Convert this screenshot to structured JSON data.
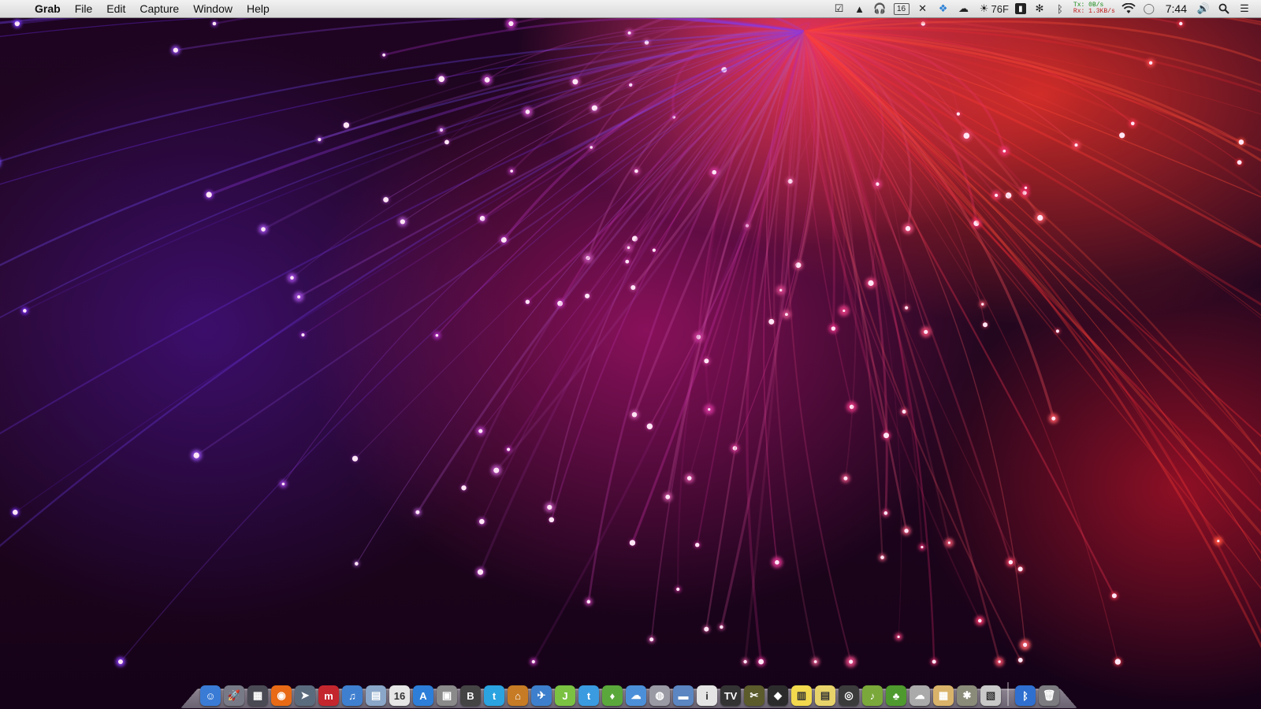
{
  "menubar": {
    "apple_glyph": "",
    "app_name": "Grab",
    "menus": [
      "File",
      "Edit",
      "Capture",
      "Window",
      "Help"
    ],
    "calendar_day": "16",
    "weather_temp": "76F",
    "net_tx_label": "Tx:",
    "net_tx_value": "0B/s",
    "net_rx_label": "Rx:",
    "net_rx_value": "1.3KB/s",
    "clock": "7:44"
  },
  "dock": {
    "items": [
      {
        "name": "finder",
        "glyph": "☺",
        "color": "#3a7bd5"
      },
      {
        "name": "launchpad",
        "glyph": "🚀",
        "color": "#777a86"
      },
      {
        "name": "mission-control",
        "glyph": "▦",
        "color": "#4a4a55"
      },
      {
        "name": "firefox",
        "glyph": "◉",
        "color": "#e86a16"
      },
      {
        "name": "sparrow",
        "glyph": "➤",
        "color": "#5b6b7e"
      },
      {
        "name": "mendeley",
        "glyph": "m",
        "color": "#c4262e"
      },
      {
        "name": "itunes",
        "glyph": "♫",
        "color": "#3f7fd0"
      },
      {
        "name": "preview",
        "glyph": "▤",
        "color": "#8aa6c8"
      },
      {
        "name": "ical",
        "glyph": "16",
        "color": "#e6e6e6"
      },
      {
        "name": "app-store",
        "glyph": "A",
        "color": "#2d7ed8"
      },
      {
        "name": "image-capture",
        "glyph": "▣",
        "color": "#8a8a8a"
      },
      {
        "name": "bbedit",
        "glyph": "B",
        "color": "#444444"
      },
      {
        "name": "twitter",
        "glyph": "t",
        "color": "#2aa3e0"
      },
      {
        "name": "home-app",
        "glyph": "⌂",
        "color": "#c77b24"
      },
      {
        "name": "xcode-tools",
        "glyph": "✈",
        "color": "#3d7fcc"
      },
      {
        "name": "jumpcut",
        "glyph": "J",
        "color": "#7bc243"
      },
      {
        "name": "tweetbot",
        "glyph": "t",
        "color": "#3a9be0"
      },
      {
        "name": "evernote",
        "glyph": "♦",
        "color": "#5aa83b"
      },
      {
        "name": "mindnode",
        "glyph": "☁",
        "color": "#4c8fd9"
      },
      {
        "name": "network-utility",
        "glyph": "◍",
        "color": "#9a9aa5"
      },
      {
        "name": "disk-utility",
        "glyph": "▬",
        "color": "#5b86c2"
      },
      {
        "name": "text-edit",
        "glyph": "i",
        "color": "#e4e4e4"
      },
      {
        "name": "tv-app",
        "glyph": "TV",
        "color": "#333333"
      },
      {
        "name": "scissors-app",
        "glyph": "✂",
        "color": "#5b5b2c"
      },
      {
        "name": "flux-app",
        "glyph": "◆",
        "color": "#2b2b2b"
      },
      {
        "name": "stickies",
        "glyph": "▥",
        "color": "#f2d94e"
      },
      {
        "name": "notes",
        "glyph": "▤",
        "color": "#e8d36a"
      },
      {
        "name": "chrome",
        "glyph": "◎",
        "color": "#3b3b3b"
      },
      {
        "name": "guitar-app",
        "glyph": "♪",
        "color": "#7aa83a"
      },
      {
        "name": "tree-app",
        "glyph": "♣",
        "color": "#4f9a2e"
      },
      {
        "name": "cloud-app",
        "glyph": "☁",
        "color": "#aaaaaa"
      },
      {
        "name": "calculator",
        "glyph": "▦",
        "color": "#d9b36a"
      },
      {
        "name": "utility-app",
        "glyph": "✱",
        "color": "#8b8b7a"
      },
      {
        "name": "photos-app",
        "glyph": "▧",
        "color": "#c9c9c9"
      },
      {
        "name": "bluetooth-file-exchange",
        "glyph": "ᛒ",
        "color": "#2f6fd0"
      },
      {
        "name": "trash",
        "glyph": "🗑",
        "color": "#7b7b80"
      }
    ]
  },
  "colors": {
    "menubar_bg": "#e6e6e6",
    "wallpaper_red": "#e8321e",
    "wallpaper_pink": "#ff3c78",
    "wallpaper_purple": "#5a14aa"
  }
}
